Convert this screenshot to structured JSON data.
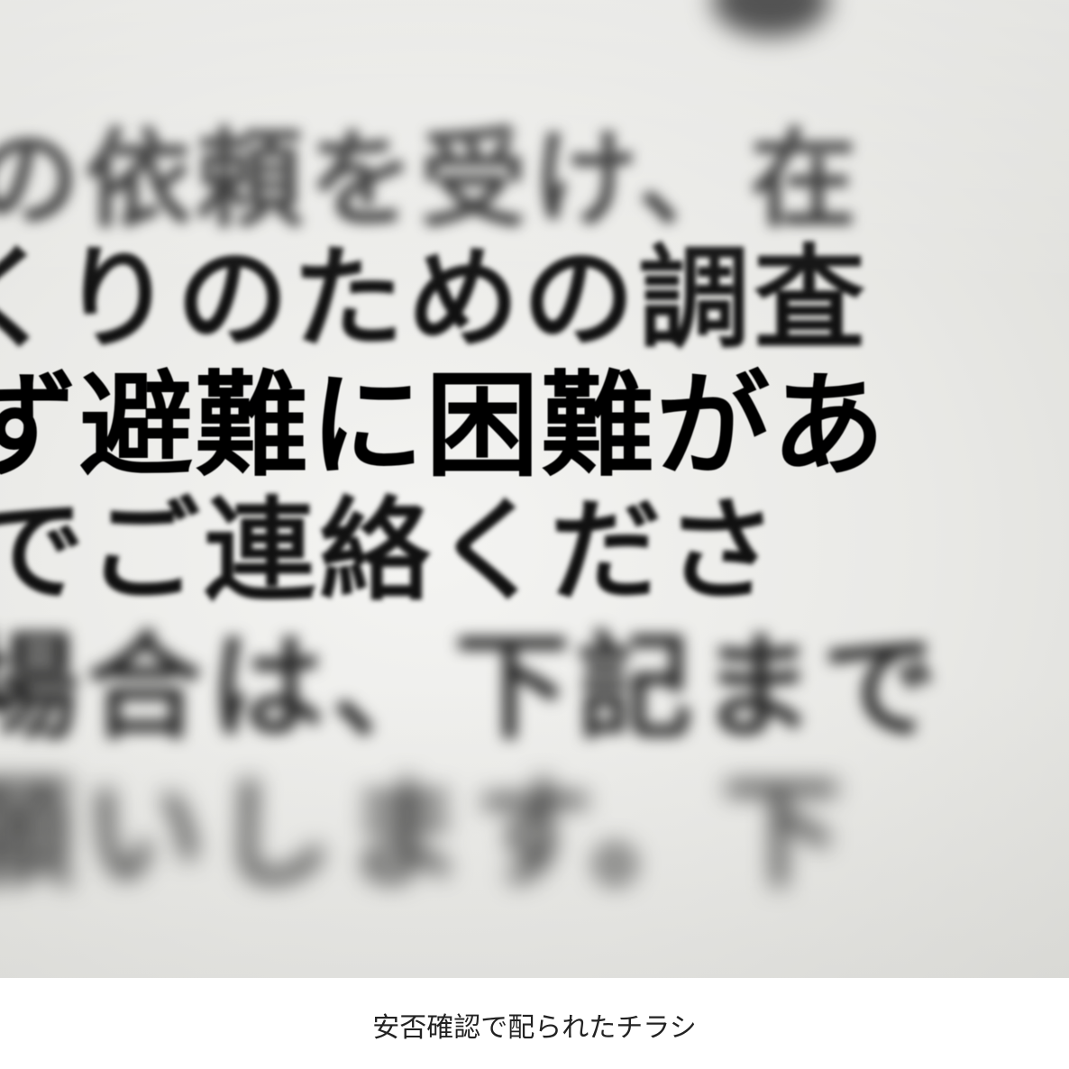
{
  "photo": {
    "text_lines": [
      "の依頼を受け、在",
      "くりのための調査",
      "ず避難に困難があ",
      "でご連絡くださ",
      "場合は、下記まで",
      "願いします。下"
    ]
  },
  "caption": "安否確認で配られたチラシ"
}
